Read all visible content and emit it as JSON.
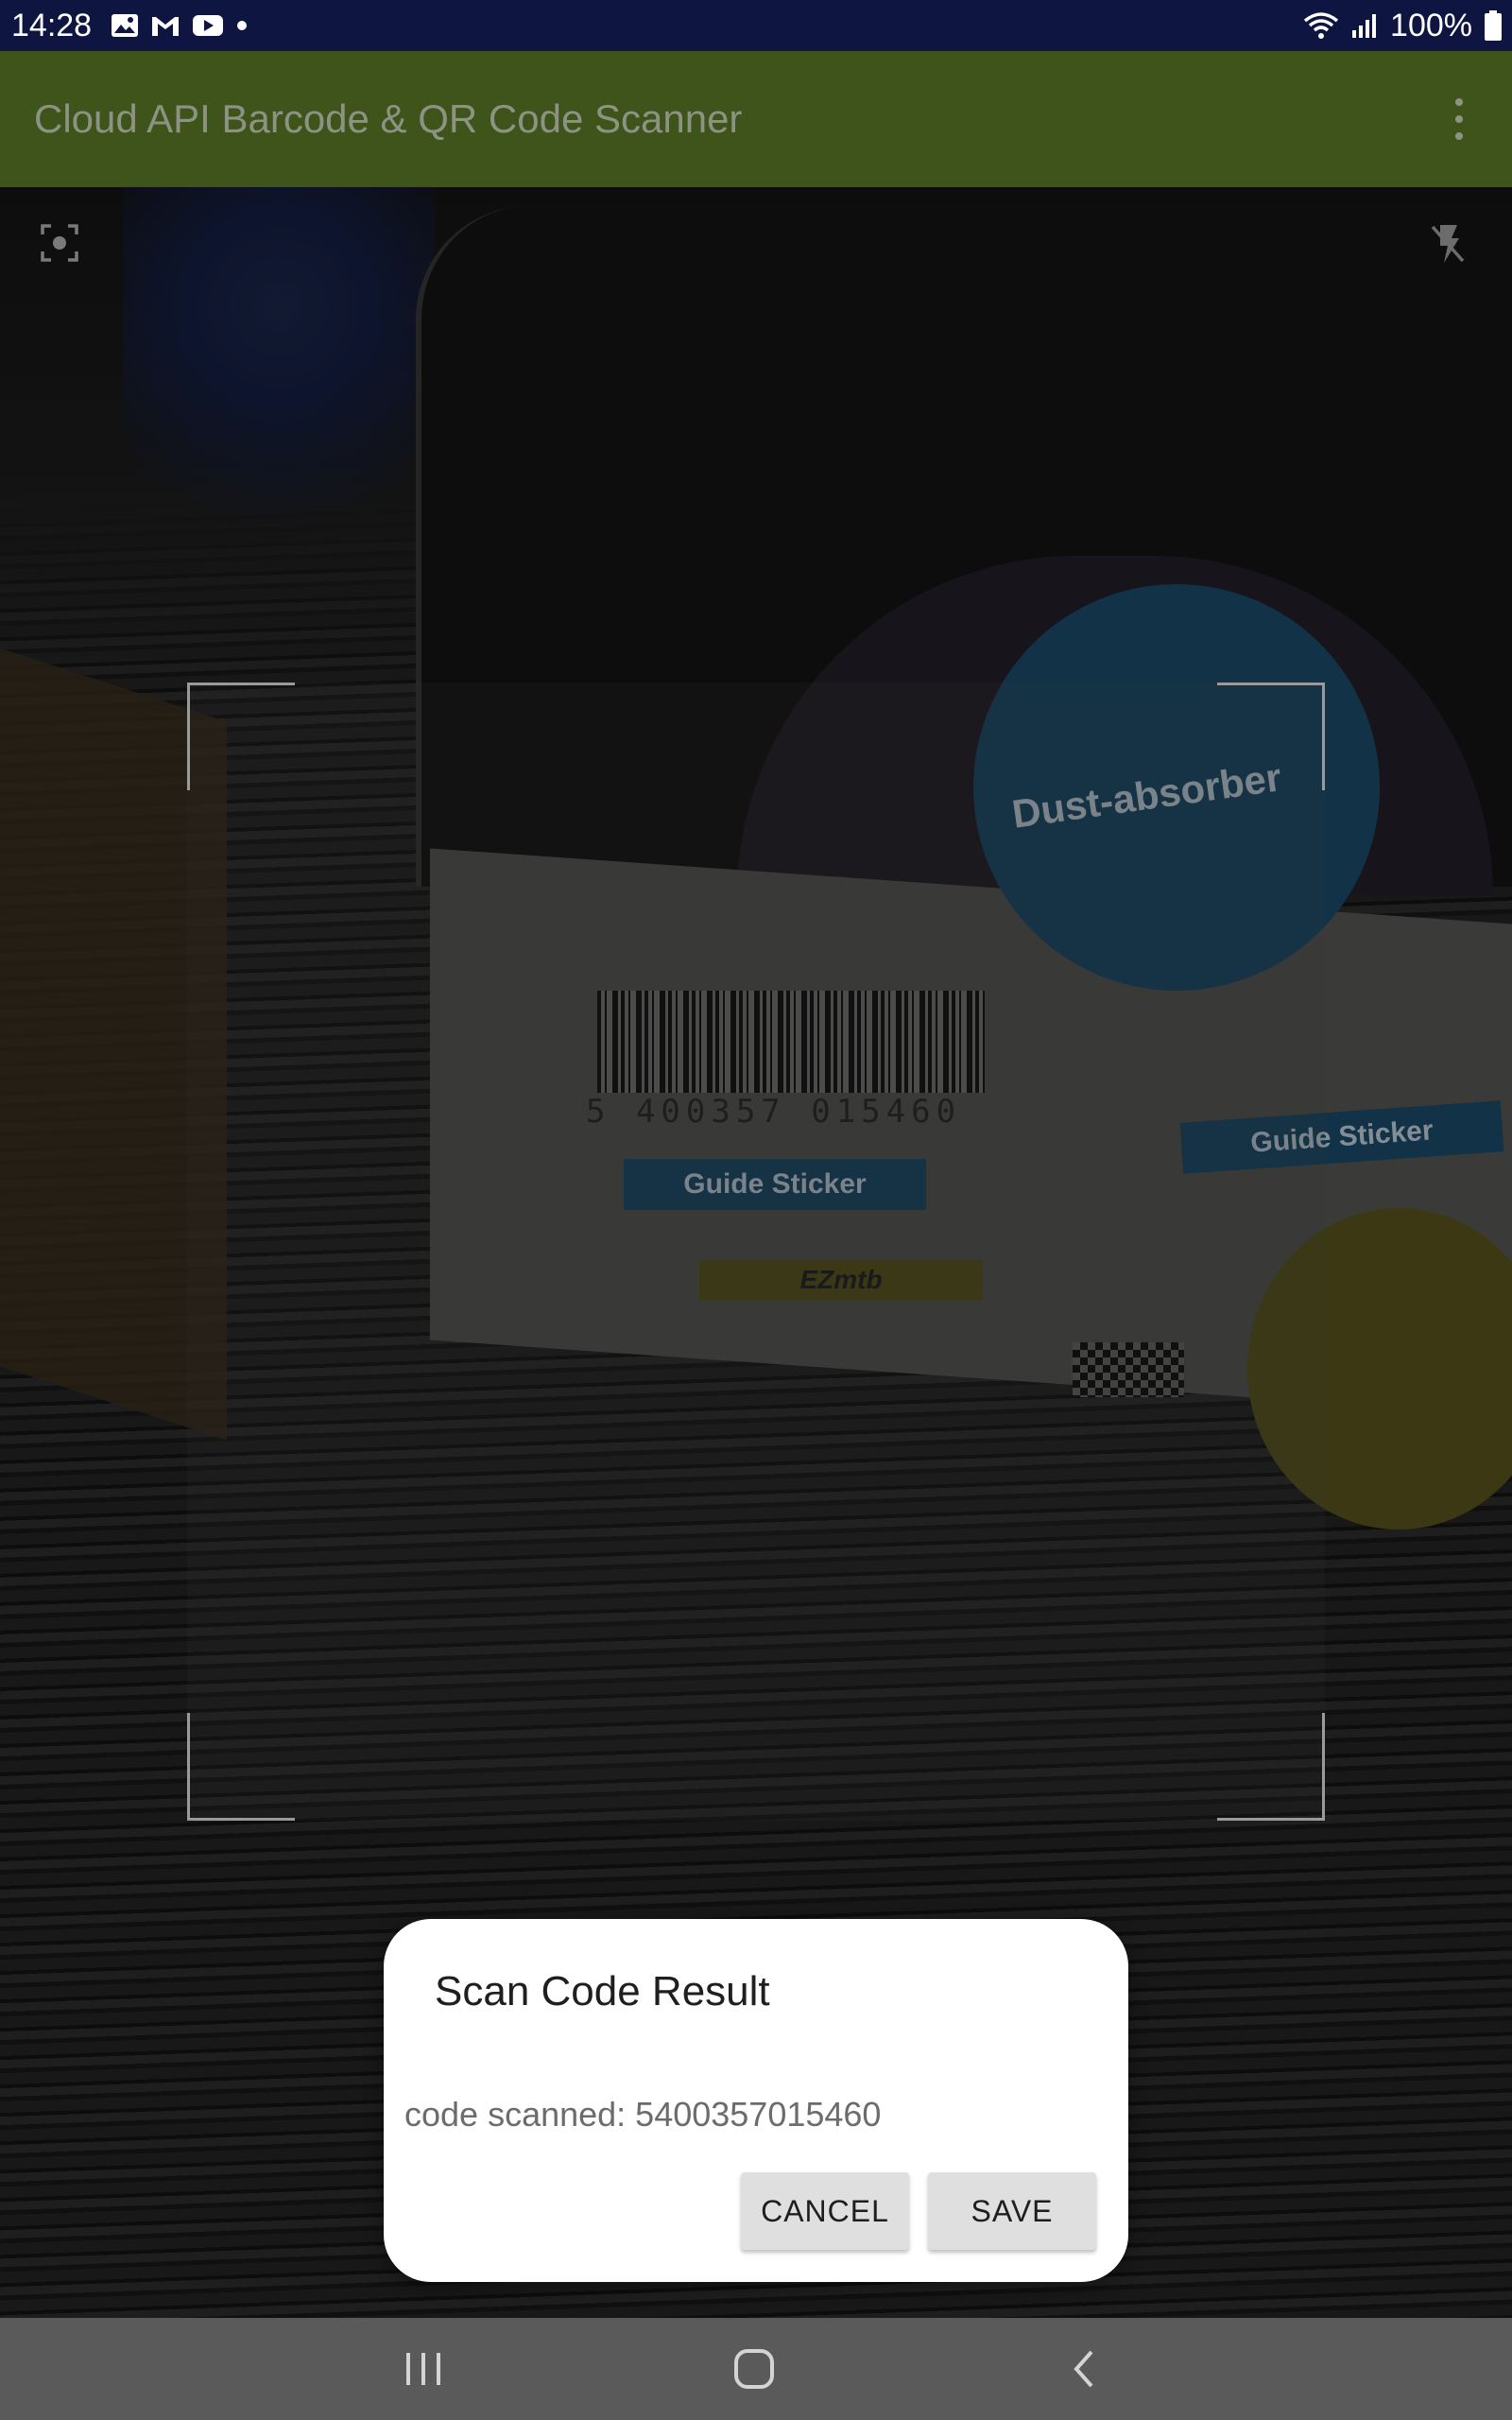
{
  "status_bar": {
    "time": "14:28",
    "battery_percent": "100%",
    "notification_icons": [
      "image-icon",
      "gmail-icon",
      "youtube-icon",
      "dot-icon"
    ],
    "system_icons": [
      "wifi-icon",
      "signal-icon",
      "battery-icon"
    ]
  },
  "app_bar": {
    "title": "Cloud API Barcode & QR Code Scanner",
    "menu_icon": "overflow-menu-icon"
  },
  "camera": {
    "left_control_icon": "focus-icon",
    "right_control_icon": "flash-off-icon",
    "preview_labels": {
      "sticker": "Dust-absorber",
      "guide_sticker": "Guide Sticker",
      "barcode_digits": "5 400357 015460",
      "brand": "EZmtb"
    }
  },
  "dialog": {
    "title": "Scan Code Result",
    "message": "code scanned: 5400357015460",
    "cancel_label": "CANCEL",
    "save_label": "SAVE"
  },
  "nav_bar": {
    "items": [
      "recents-icon",
      "home-icon",
      "back-icon"
    ]
  },
  "colors": {
    "status_bar": "#0d1540",
    "app_bar": "#3e541b",
    "nav_bar": "#5a5a5a",
    "dialog_bg": "#ffffff",
    "button_bg": "#dfdfdf"
  }
}
